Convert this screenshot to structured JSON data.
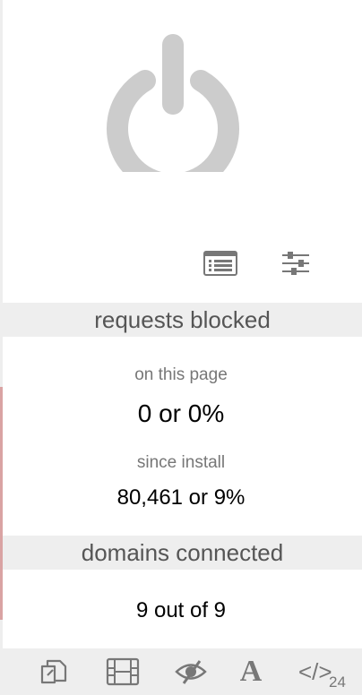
{
  "power": {
    "icon": "power-icon",
    "state": "off",
    "color": "#cccccc"
  },
  "controls": {
    "logger_icon": "list-icon",
    "settings_icon": "sliders-icon"
  },
  "requests": {
    "header": "requests blocked",
    "page_label": "on this page",
    "page_value": "0 or 0%",
    "install_label": "since install",
    "install_value": "80,461 or 9%"
  },
  "domains": {
    "header": "domains connected",
    "value": "9 out of 9"
  },
  "toolbar": {
    "tools": [
      {
        "name": "popups-icon"
      },
      {
        "name": "media-icon"
      },
      {
        "name": "cosmetic-filter-icon"
      },
      {
        "name": "remote-fonts-icon",
        "glyph": "A"
      },
      {
        "name": "scripts-icon",
        "glyph": "</>",
        "count": "24"
      }
    ]
  },
  "colors": {
    "icon_gray": "#777777",
    "header_bg": "#eeeeee"
  }
}
